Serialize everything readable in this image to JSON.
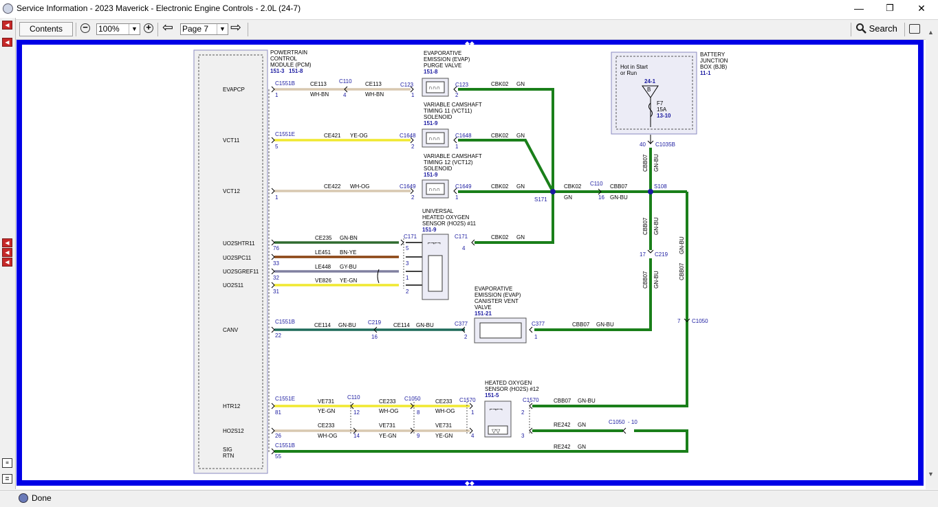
{
  "window": {
    "title": "Service Information - 2023 Maverick - Electronic Engine Controls - 2.0L (24-7)",
    "minimize": "—",
    "maximize": "❐",
    "close": "✕"
  },
  "toolbar": {
    "contents_label": "Contents",
    "zoom_out": "−",
    "zoom_value": "100%",
    "zoom_in": "+",
    "page_value": "Page 7",
    "prev_page": "⇦",
    "next_page": "⇨",
    "search_label": "Search",
    "icons": [
      "zoom-out-icon",
      "zoom-in-icon",
      "arrow-left-icon",
      "arrow-right-icon",
      "search-icon",
      "print-icon"
    ]
  },
  "left_sidebar": {
    "buttons": [
      "nav-icon",
      "nav-icon",
      "nav-icon",
      "nav-icon",
      "nav-icon"
    ],
    "bottom_icons": [
      "document-icon",
      "list-icon"
    ]
  },
  "status": {
    "text": "Done"
  },
  "colors": {
    "frame": "#0000e6",
    "wire_green": "#1a7f1a",
    "pin_blue": "#1a1aa0",
    "wire_yellow": "#f0e830",
    "wire_whbn": "#d8c8b0",
    "wire_brown": "#8b4513",
    "wire_gray": "#8080a0"
  },
  "diagram": {
    "pcm": {
      "title_lines": [
        "POWERTRAIN",
        "CONTROL",
        "MODULE (PCM)"
      ],
      "refs": [
        "151-3",
        "151-8"
      ],
      "pins": [
        "EVAPCP",
        "VCT11",
        "VCT12",
        "UO2SHTR11",
        "UO2SPC11",
        "UO2SGREF11",
        "UO2S11",
        "CANV",
        "HTR12",
        "HO2S12",
        "SIG",
        "RTN"
      ]
    },
    "components": {
      "evap_purge": {
        "lines": [
          "EVAPORATIVE",
          "EMISSION (EVAP)",
          "PURGE VALVE"
        ],
        "ref": "151-8"
      },
      "vct11": {
        "lines": [
          "VARIABLE CAMSHAFT",
          "TIMING 11 (VCT11)",
          "SOLENOID"
        ],
        "ref": "151-9"
      },
      "vct12": {
        "lines": [
          "VARIABLE CAMSHAFT",
          "TIMING 12 (VCT12)",
          "SOLENOID"
        ],
        "ref": "151-9"
      },
      "ho2s11": {
        "lines": [
          "UNIVERSAL",
          "HEATED OXYGEN",
          "SENSOR (HO2S) #11"
        ],
        "ref": "151-9"
      },
      "evap_vent": {
        "lines": [
          "EVAPORATIVE",
          "EMISSION (EVAP)",
          "CANISTER VENT",
          "VALVE"
        ],
        "ref": "151-21"
      },
      "ho2s12": {
        "lines": [
          "HEATED OXYGEN",
          "SENSOR (HO2S) #12"
        ],
        "ref": "151-5"
      },
      "bjb": {
        "lines": [
          "BATTERY",
          "JUNCTION",
          "BOX (BJB)"
        ],
        "ref": "11-1",
        "hot_lines": [
          "Hot in Start",
          "or Run"
        ],
        "fuse_ref": "24-1",
        "fuse_letter": "B",
        "fuse_lines": [
          "F7",
          "15A"
        ],
        "fuse_loc": "13-10"
      }
    },
    "connectors": {
      "c1551b": "C1551B",
      "c1551e": "C1551E",
      "c110": "C110",
      "c123": "C123",
      "c1648": "C1648",
      "c1649": "C1649",
      "c171": "C171",
      "c219": "C219",
      "c377": "C377",
      "c1050": "C1050",
      "c1570": "C1570",
      "c1035b": "C1035B",
      "s171": "S171",
      "s108": "S108",
      "c1050_10": "C1050",
      "dash10": "- 10"
    },
    "circuits": {
      "ce113": "CE113",
      "whbn": "WH-BN",
      "ce421": "CE421",
      "yeog": "YE-OG",
      "ce422": "CE422",
      "whog": "WH-OG",
      "ce235": "CE235",
      "gnbn": "GN-BN",
      "le451": "LE451",
      "bnye": "BN-YE",
      "le448": "LE448",
      "gybu": "GY-BU",
      "ve826": "VE826",
      "yegn": "YE-GN",
      "ce114": "CE114",
      "gnbu": "GN-BU",
      "cbk02": "CBK02",
      "gn": "GN",
      "cbb07": "CBB07",
      "ve731": "VE731",
      "ce233": "CE233",
      "re242": "RE242"
    },
    "pin_numbers": {
      "p1": "1",
      "p2": "2",
      "p3": "3",
      "p4": "4",
      "p5": "5",
      "p7": "7",
      "p9": "9",
      "p8": "8",
      "p12": "12",
      "p14": "14",
      "p16": "16",
      "p17": "17",
      "p22": "22",
      "p26": "26",
      "p31": "31",
      "p32": "32",
      "p33": "33",
      "p40": "40",
      "p55": "55",
      "p76": "76",
      "p81": "81"
    }
  }
}
